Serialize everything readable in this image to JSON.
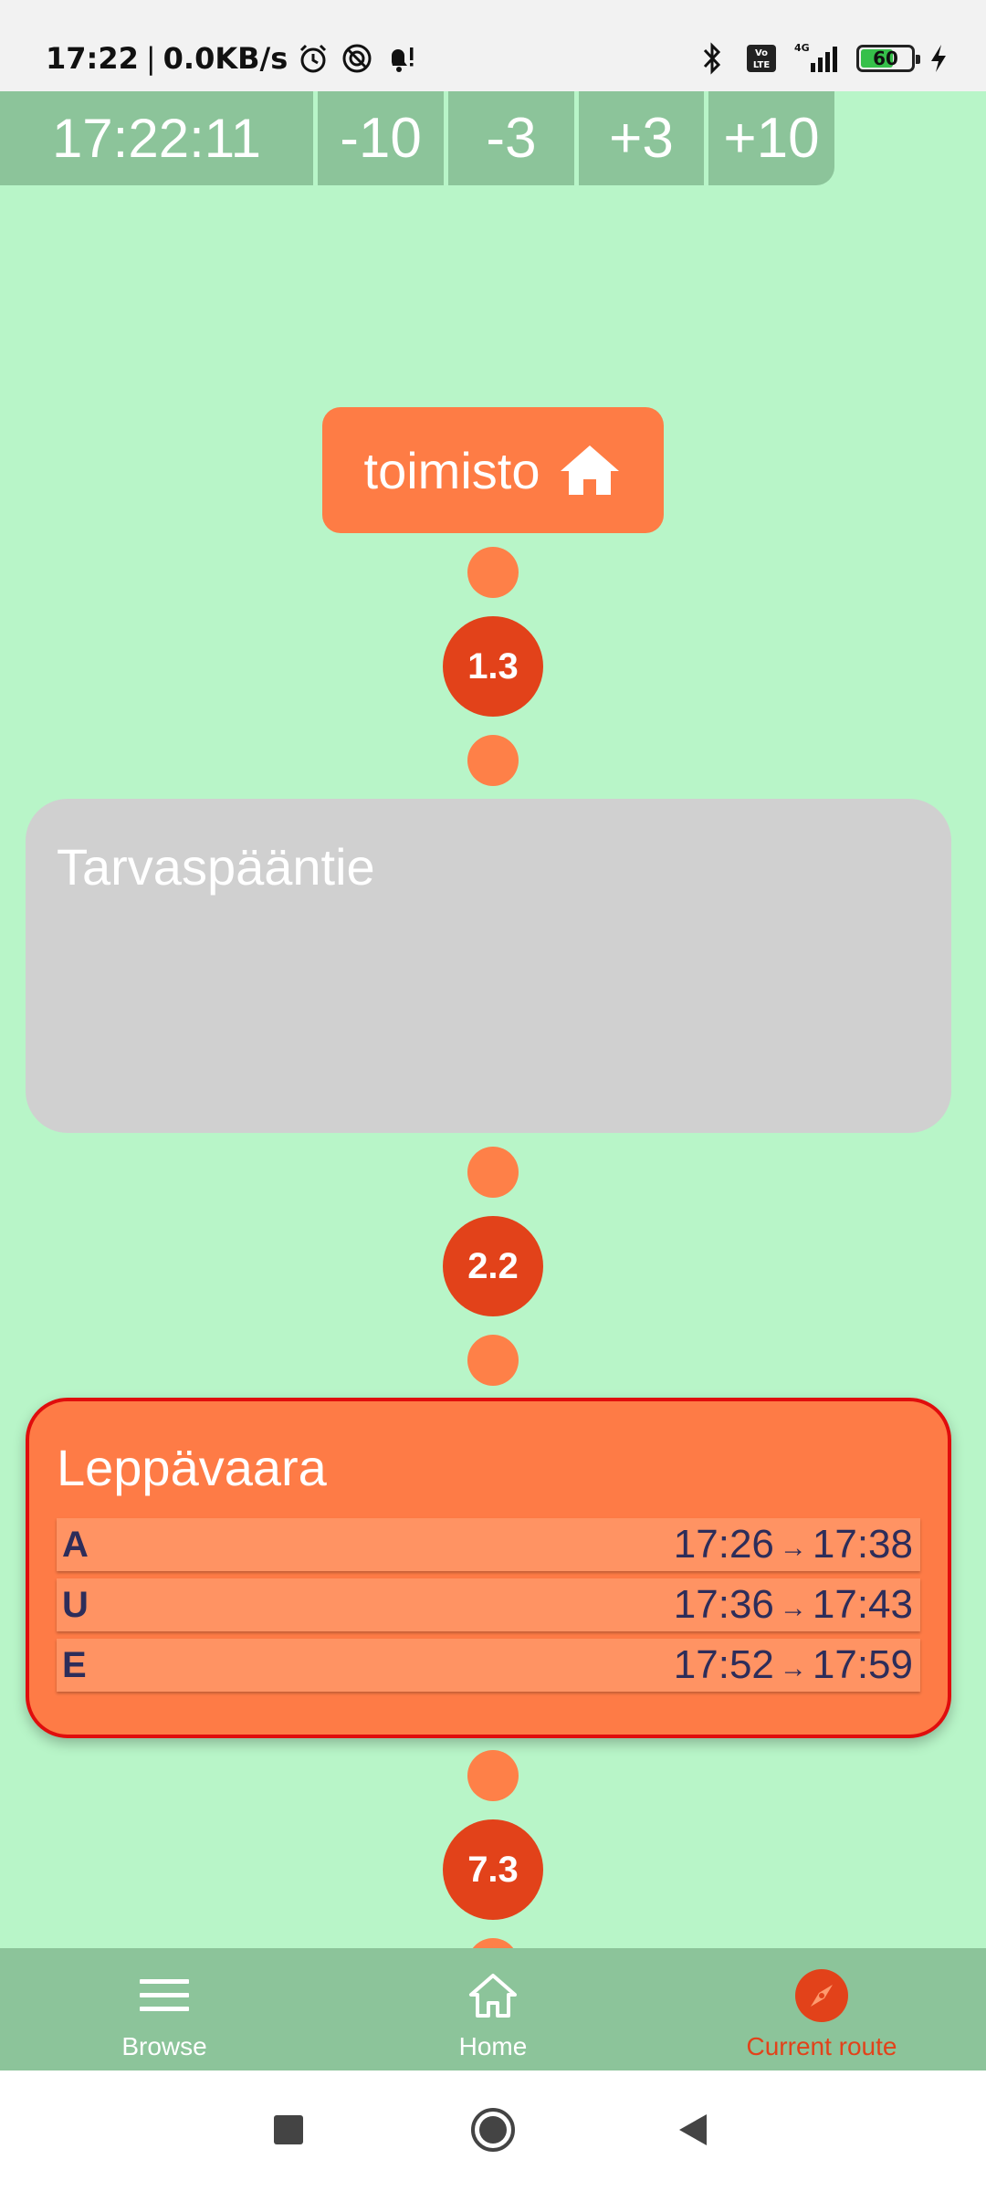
{
  "status_bar": {
    "time": "17:22",
    "net_speed": "0.0KB/s",
    "battery": "60",
    "network": "4G",
    "volte": "Vo LTE"
  },
  "time_controls": {
    "current_time": "17:22:11",
    "buttons": [
      "-10",
      "-3",
      "+3",
      "+10"
    ]
  },
  "route": {
    "start_stop": {
      "label": "toimisto",
      "icon": "home-icon"
    },
    "segments": [
      "1.3",
      "2.2",
      "7.3"
    ],
    "stops": [
      {
        "name": "Tarvaspääntie",
        "departures": []
      },
      {
        "name": "Leppävaara",
        "departures": [
          {
            "line": "A",
            "depart": "17:26",
            "arrive": "17:38"
          },
          {
            "line": "U",
            "depart": "17:36",
            "arrive": "17:43"
          },
          {
            "line": "E",
            "depart": "17:52",
            "arrive": "17:59"
          }
        ]
      }
    ],
    "arrow": "→"
  },
  "bottom_nav": {
    "items": [
      {
        "label": "Browse",
        "icon": "menu-icon"
      },
      {
        "label": "Home",
        "icon": "home-outline-icon"
      },
      {
        "label": "Current route",
        "icon": "compass-icon"
      }
    ]
  },
  "colors": {
    "background": "#b8f5c8",
    "bar": "#8cc49a",
    "accent": "#fe7c45",
    "distance": "#e2421a",
    "highlight_border": "#e00d0d",
    "stop_grey": "#d0d0d0",
    "text_dark": "#2d2d5a"
  }
}
